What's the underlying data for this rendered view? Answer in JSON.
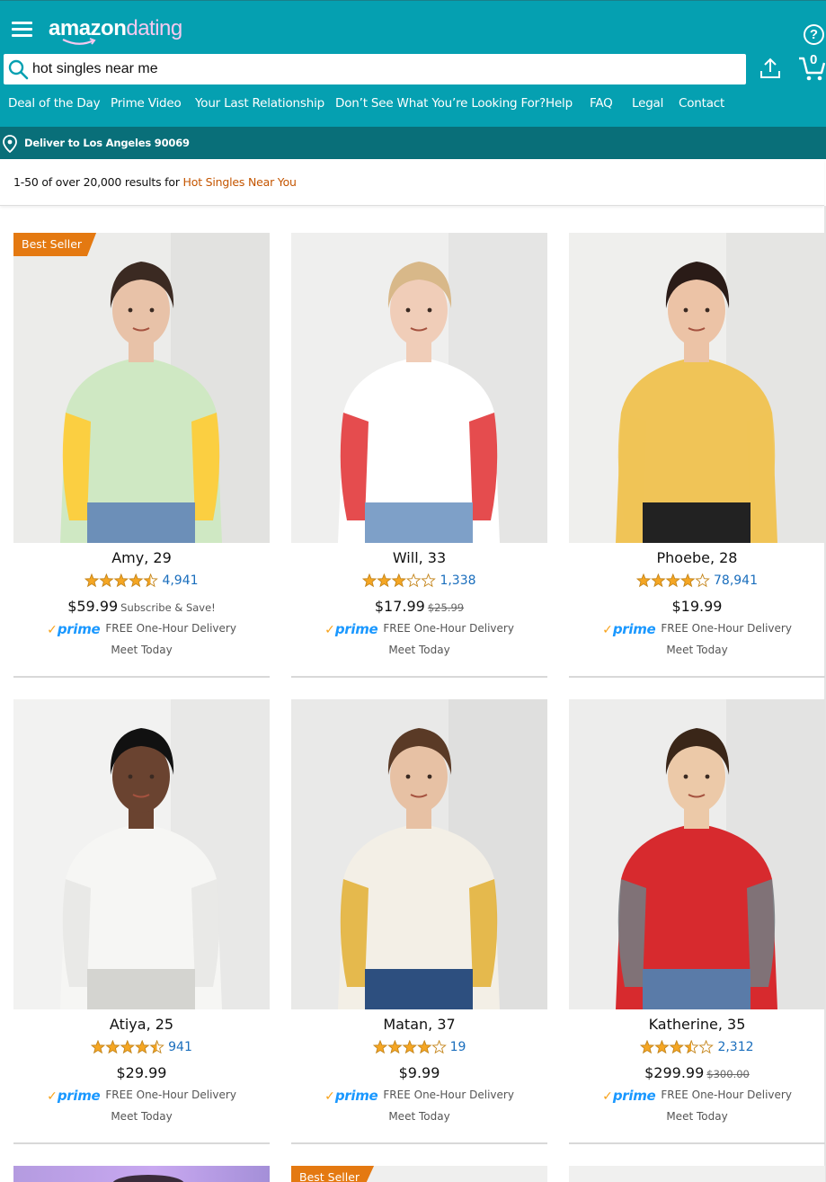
{
  "header": {
    "logo_primary": "amazon",
    "logo_secondary": "dating",
    "help_label": "?",
    "cart_count": "0",
    "brand_color": "#05a0b1",
    "logo_accent": "#f5c9ef"
  },
  "search": {
    "value": "hot singles near me",
    "placeholder": ""
  },
  "nav": {
    "items": [
      "Deal of the Day",
      "Prime Video",
      "Your Last Relationship",
      "Don’t See What You’re Looking For?",
      "Help",
      "FAQ",
      "Legal",
      "Contact"
    ]
  },
  "delivery": {
    "text": "Deliver to Los Angeles 90069"
  },
  "results": {
    "prefix": "1-50 of over 20,000 results for ",
    "query": "Hot Singles Near You"
  },
  "products": [
    {
      "name": "Amy, 29",
      "rating": 4.5,
      "reviews": "4,941",
      "price": "$59.99",
      "was": "",
      "note": "Subscribe & Save!",
      "badge": "Best Seller",
      "prime": "prime",
      "delivery": "FREE One-Hour Delivery",
      "meet": "Meet Today"
    },
    {
      "name": "Will, 33",
      "rating": 3.0,
      "reviews": "1,338",
      "price": "$17.99",
      "was": "$25.99",
      "note": "",
      "badge": "",
      "prime": "prime",
      "delivery": "FREE One-Hour Delivery",
      "meet": "Meet Today"
    },
    {
      "name": "Phoebe, 28",
      "rating": 4.0,
      "reviews": "78,941",
      "price": "$19.99",
      "was": "",
      "note": "",
      "badge": "",
      "prime": "prime",
      "delivery": "FREE One-Hour Delivery",
      "meet": "Meet Today"
    },
    {
      "name": "Atiya, 25",
      "rating": 4.5,
      "reviews": "941",
      "price": "$29.99",
      "was": "",
      "note": "",
      "badge": "",
      "prime": "prime",
      "delivery": "FREE One-Hour Delivery",
      "meet": "Meet Today"
    },
    {
      "name": "Matan, 37",
      "rating": 4.0,
      "reviews": "19",
      "price": "$9.99",
      "was": "",
      "note": "",
      "badge": "",
      "prime": "prime",
      "delivery": "FREE One-Hour Delivery",
      "meet": "Meet Today"
    },
    {
      "name": "Katherine, 35",
      "rating": 3.5,
      "reviews": "2,312",
      "price": "$299.99",
      "was": "$300.00",
      "note": "",
      "badge": "",
      "prime": "prime",
      "delivery": "FREE One-Hour Delivery",
      "meet": "Meet Today"
    }
  ],
  "next_row": {
    "badge": "Best Seller"
  },
  "colors": {
    "star": "#f5a623",
    "link": "#1a6ebd",
    "badge": "#e47911",
    "query": "#c45500",
    "prime": "#1a98ff"
  }
}
